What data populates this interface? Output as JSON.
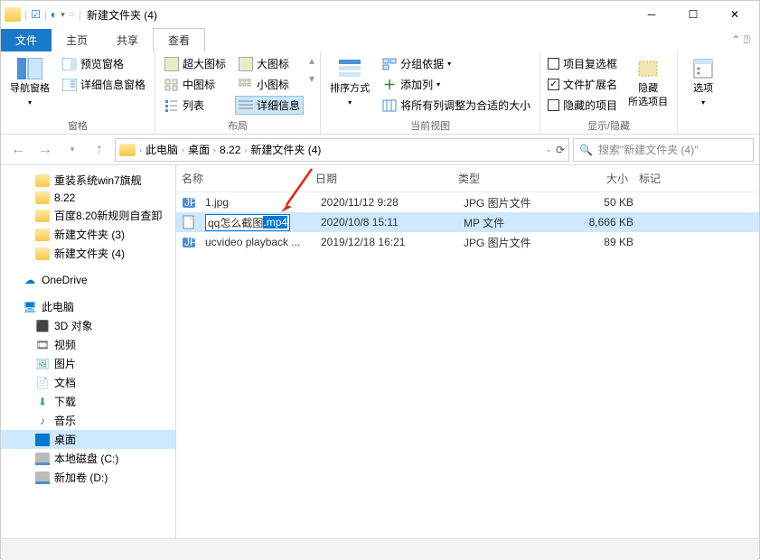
{
  "title": "新建文件夹 (4)",
  "tabs": {
    "file": "文件",
    "home": "主页",
    "share": "共享",
    "view": "查看"
  },
  "ribbon": {
    "panes": {
      "nav_pane": "导航窗格",
      "preview": "预览窗格",
      "details": "详细信息窗格",
      "label": "窗格"
    },
    "layout": {
      "extra_large": "超大图标",
      "large": "大图标",
      "medium": "中图标",
      "small": "小图标",
      "list": "列表",
      "details": "详细信息",
      "label": "布局"
    },
    "current": {
      "sort": "排序方式",
      "group": "分组依据",
      "add_col": "添加列",
      "fit": "将所有列调整为合适的大小",
      "label": "当前视图"
    },
    "showhide": {
      "item_chk": "项目复选框",
      "ext": "文件扩展名",
      "hidden_items": "隐藏的项目",
      "hide": "隐藏",
      "hide2": "所选项目",
      "label": "显示/隐藏"
    },
    "options": "选项"
  },
  "breadcrumb": [
    "此电脑",
    "桌面",
    "8.22",
    "新建文件夹 (4)"
  ],
  "search_placeholder": "搜索\"新建文件夹 (4)\"",
  "tree": {
    "items": [
      {
        "icon": "folder",
        "label": "重装系统win7旗舰",
        "indent": 2
      },
      {
        "icon": "folder",
        "label": "8.22",
        "indent": 2
      },
      {
        "icon": "folder",
        "label": "百度8.20新规则自查卸",
        "indent": 2
      },
      {
        "icon": "folder",
        "label": "新建文件夹 (3)",
        "indent": 2
      },
      {
        "icon": "folder",
        "label": "新建文件夹 (4)",
        "indent": 2
      },
      {
        "icon": "spacer"
      },
      {
        "icon": "onedrive",
        "label": "OneDrive",
        "indent": 1
      },
      {
        "icon": "spacer"
      },
      {
        "icon": "pc",
        "label": "此电脑",
        "indent": 1
      },
      {
        "icon": "3d",
        "label": "3D 对象",
        "indent": 2
      },
      {
        "icon": "video",
        "label": "视频",
        "indent": 2
      },
      {
        "icon": "pic",
        "label": "图片",
        "indent": 2
      },
      {
        "icon": "doc",
        "label": "文档",
        "indent": 2
      },
      {
        "icon": "dl",
        "label": "下载",
        "indent": 2
      },
      {
        "icon": "music",
        "label": "音乐",
        "indent": 2
      },
      {
        "icon": "desk",
        "label": "桌面",
        "indent": 2,
        "selected": true
      },
      {
        "icon": "disk",
        "label": "本地磁盘 (C:)",
        "indent": 2
      },
      {
        "icon": "disk",
        "label": "新加卷 (D:)",
        "indent": 2
      }
    ]
  },
  "columns": {
    "name": "名称",
    "date": "日期",
    "type": "类型",
    "size": "大小",
    "tag": "标记"
  },
  "files": [
    {
      "icon": "jpg",
      "name": "1.jpg",
      "date": "2020/11/12 9:28",
      "type": "JPG 图片文件",
      "size": "50 KB"
    },
    {
      "icon": "file",
      "name_prefix": "qq怎么截图",
      "name_sel": ".mp4",
      "date": "2020/10/8 15:11",
      "type": "MP 文件",
      "size": "8,666 KB",
      "editing": true,
      "selected": true
    },
    {
      "icon": "jpg",
      "name": "ucvideo playback ...",
      "date": "2019/12/18 16:21",
      "type": "JPG 图片文件",
      "size": "89 KB"
    }
  ]
}
